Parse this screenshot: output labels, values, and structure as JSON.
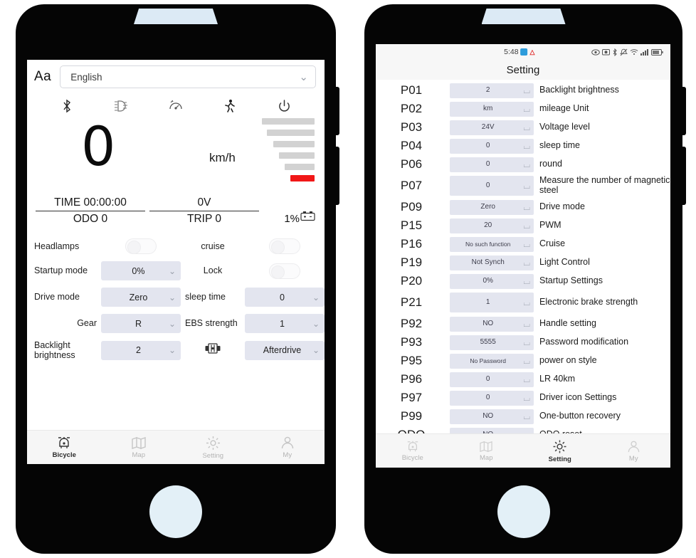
{
  "left_phone": {
    "language_bar": {
      "aa_label": "Aa",
      "selected_language": "English"
    },
    "status_icons": [
      {
        "name": "bluetooth-icon",
        "label": "Bluetooth"
      },
      {
        "name": "headlight-icon",
        "label": "Headlight"
      },
      {
        "name": "cruise-icon",
        "label": "Cruise"
      },
      {
        "name": "walk-mode-icon",
        "label": "Walk mode"
      },
      {
        "name": "power-icon",
        "label": "Power"
      }
    ],
    "dashboard": {
      "speed_value": "0",
      "speed_unit": "km/h",
      "battery_bars": 6,
      "battery_red_index": 5,
      "accent_red": "#f11717"
    },
    "stats": {
      "time_label": "TIME 00:00:00",
      "odo_label": "ODO 0",
      "voltage_label": "0V",
      "trip_label": "TRIP 0",
      "battery_percent": "1%"
    },
    "controls": {
      "headlamps_label": "Headlamps",
      "headlamps_state": "off",
      "cruise_label": "cruise",
      "cruise_state": "off",
      "lock_label": "Lock",
      "lock_state": "off",
      "startup_mode_label": "Startup mode",
      "startup_mode_value": "0%",
      "drive_mode_label": "Drive mode",
      "drive_mode_value": "Zero",
      "sleep_time_label": "sleep time",
      "sleep_time_value": "0",
      "gear_label": "Gear",
      "gear_value": "R",
      "ebs_strength_label": "EBS strength",
      "ebs_strength_value": "1",
      "backlight_label": "Backlight brightness",
      "backlight_value": "2",
      "afterdrive_icon": "motor-icon",
      "afterdrive_value": "Afterdrive"
    },
    "tabbar": [
      {
        "label": "Bicycle",
        "icon": "bicycle-icon",
        "active": true
      },
      {
        "label": "Map",
        "icon": "map-icon",
        "active": false
      },
      {
        "label": "Setting",
        "icon": "gear-icon",
        "active": false
      },
      {
        "label": "My",
        "icon": "person-icon",
        "active": false
      }
    ]
  },
  "right_phone": {
    "statusbar": {
      "time": "5:48",
      "icons": [
        "eye-icon",
        "camera-icon",
        "bluetooth-icon",
        "mute-icon",
        "wifi-icon",
        "signal-icon",
        "battery-icon"
      ]
    },
    "title": "Setting",
    "rows": [
      {
        "code": "P01",
        "value": "2",
        "label": "Backlight brightness",
        "tall": false
      },
      {
        "code": "P02",
        "value": "km",
        "label": "mileage Unit",
        "tall": false
      },
      {
        "code": "P03",
        "value": "24V",
        "label": "Voltage level",
        "tall": false
      },
      {
        "code": "P04",
        "value": "0",
        "label": "sleep time",
        "tall": false
      },
      {
        "code": "P06",
        "value": "0",
        "label": "round",
        "tall": false
      },
      {
        "code": "P07",
        "value": "0",
        "label": "Measure the number of magnetic steel",
        "tall": true
      },
      {
        "code": "P09",
        "value": "Zero",
        "label": "Drive mode",
        "tall": false
      },
      {
        "code": "P15",
        "value": "20",
        "label": "PWM",
        "tall": false
      },
      {
        "code": "P16",
        "value": "No such function",
        "label": "Cruise",
        "tall": false
      },
      {
        "code": "P19",
        "value": "Not Synch",
        "label": "Light Control",
        "tall": false
      },
      {
        "code": "P20",
        "value": "0%",
        "label": "Startup Settings",
        "tall": false
      },
      {
        "code": "P21",
        "value": "1",
        "label": "Electronic brake strength",
        "tall": true
      },
      {
        "code": "P92",
        "value": "NO",
        "label": "Handle setting",
        "tall": false
      },
      {
        "code": "P93",
        "value": "5555",
        "label": "Password modification",
        "tall": false
      },
      {
        "code": "P95",
        "value": "No Password",
        "label": "power on style",
        "tall": false
      },
      {
        "code": "P96",
        "value": "0",
        "label": "LR 40km",
        "tall": false
      },
      {
        "code": "P97",
        "value": "0",
        "label": "Driver icon Settings",
        "tall": false
      },
      {
        "code": "P99",
        "value": "NO",
        "label": "One-button recovery",
        "tall": false
      },
      {
        "code": "ODO",
        "value": "NO",
        "label": "ODO reset",
        "tall": false
      }
    ],
    "tabbar": [
      {
        "label": "Bicycle",
        "icon": "bicycle-icon",
        "active": false
      },
      {
        "label": "Map",
        "icon": "map-icon",
        "active": false
      },
      {
        "label": "Setting",
        "icon": "gear-icon",
        "active": true
      },
      {
        "label": "My",
        "icon": "person-icon",
        "active": false
      }
    ]
  }
}
